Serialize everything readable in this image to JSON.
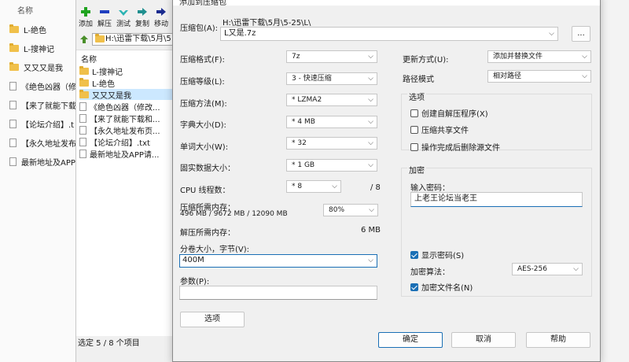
{
  "explorer": {
    "header": "名称",
    "items": [
      {
        "type": "folder",
        "label": "L-绝色"
      },
      {
        "type": "folder",
        "label": "L-搜神记"
      },
      {
        "type": "folder",
        "label": "又又又是我"
      },
      {
        "type": "file",
        "label": "《绝色凶器（修"
      },
      {
        "type": "file",
        "label": "【来了就能下载"
      },
      {
        "type": "file",
        "label": "【论坛介绍】.t"
      },
      {
        "type": "file",
        "label": "【永久地址发布"
      },
      {
        "type": "file",
        "label": "最新地址及APP"
      }
    ]
  },
  "file_manager": {
    "toolbar": [
      {
        "label": "添加",
        "icon": "plus-icon"
      },
      {
        "label": "解压",
        "icon": "minus-icon"
      },
      {
        "label": "测试",
        "icon": "check-icon"
      },
      {
        "label": "复制",
        "icon": "copy-arrow-icon"
      },
      {
        "label": "移动",
        "icon": "move-arrow-icon"
      }
    ],
    "address": "H:\\迅雷下载\\5月\\5",
    "column_header": "名称",
    "items": [
      {
        "type": "folder",
        "label": "L-搜神记",
        "selected": false
      },
      {
        "type": "folder",
        "label": "L-绝色",
        "selected": false
      },
      {
        "type": "folder",
        "label": "又又又是我",
        "selected": true
      },
      {
        "type": "file",
        "label": "《绝色凶器（修改...",
        "selected": false
      },
      {
        "type": "file",
        "label": "【来了就能下载和...",
        "selected": false
      },
      {
        "type": "file",
        "label": "【永久地址发布页...",
        "selected": false
      },
      {
        "type": "file",
        "label": "【论坛介绍】.txt",
        "selected": false
      },
      {
        "type": "file",
        "label": "最新地址及APP请...",
        "selected": false
      }
    ],
    "status": "选定 5 / 8 个项目"
  },
  "dialog": {
    "title": "添加到压缩包",
    "archive_label": "压缩包(A):",
    "archive_path": "H:\\迅雷下载\\5月\\5-25\\L\\",
    "archive_name": "L又是.7z",
    "browse_label": "...",
    "left": {
      "format_label": "压缩格式(F):",
      "format_value": "7z",
      "level_label": "压缩等级(L):",
      "level_value": "3 - 快速压缩",
      "method_label": "压缩方法(M):",
      "method_value": "* LZMA2",
      "dict_label": "字典大小(D):",
      "dict_value": "* 4 MB",
      "word_label": "单词大小(W):",
      "word_value": "* 32",
      "solid_label": "固实数据大小：",
      "solid_value": "* 1 GB",
      "cpu_label": "CPU 线程数：",
      "cpu_value": "* 8",
      "cpu_max": "/ 8",
      "mem_label": "压缩所需内存：",
      "mem_detail": "496 MB / 9672 MB / 12090 MB",
      "mem_percent": "80%",
      "decomp_label": "解压所需内存：",
      "decomp_value": "6 MB",
      "split_label": "分卷大小，字节(V):",
      "split_value": "400M",
      "params_label": "参数(P):",
      "params_value": "",
      "options_button": "选项"
    },
    "right": {
      "update_label": "更新方式(U):",
      "update_value": "添加并替换文件",
      "path_label": "路径模式",
      "path_value": "相对路径",
      "options_group": "选项",
      "opt_sfx": {
        "label": "创建自解压程序(X)",
        "checked": false
      },
      "opt_shared": {
        "label": "压缩共享文件",
        "checked": false
      },
      "opt_delete": {
        "label": "操作完成后删除源文件",
        "checked": false
      },
      "encrypt_group": "加密",
      "password_label": "输入密码：",
      "password_value": "上老王论坛当老王",
      "show_password": {
        "label": "显示密码(S)",
        "checked": true
      },
      "enc_method_label": "加密算法：",
      "enc_method_value": "AES-256",
      "encrypt_names": {
        "label": "加密文件名(N)",
        "checked": true
      }
    },
    "buttons": {
      "ok": "确定",
      "cancel": "取消",
      "help": "帮助"
    }
  },
  "colors": {
    "accent": "#1a6fb5",
    "selection": "#cce8ff",
    "folder": "#f0c04a"
  }
}
